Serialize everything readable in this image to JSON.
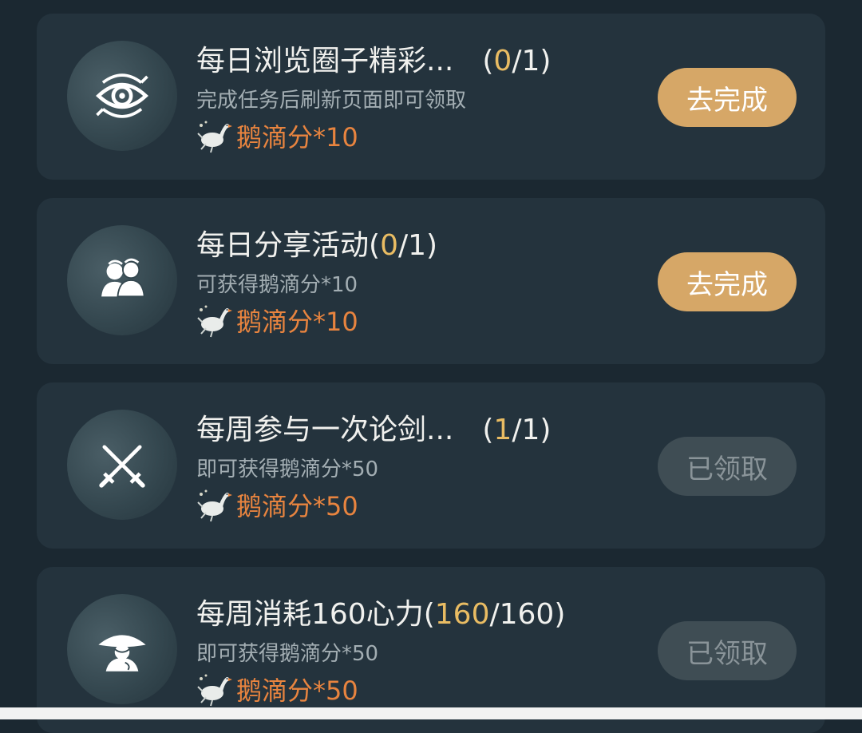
{
  "colors": {
    "page_background": "#1b2831",
    "card_background": "#24333d",
    "title_text": "#f1f1ee",
    "progress_done": "#e9bc63",
    "description_text": "#a3aeb3",
    "reward_text": "#e8843f",
    "button_active": "#d6a767",
    "button_claimed": "#3f4d54"
  },
  "tasks": [
    {
      "icon": "eye-icon",
      "title": "每日浏览圈子精彩...",
      "gap": "　",
      "progress_open": "(",
      "progress_done": "0",
      "progress_total": "/1)",
      "description": "完成任务后刷新页面即可领取",
      "reward_icon": "goose-reward-icon",
      "reward": "鹅滴分*10",
      "button": "去完成",
      "button_state": "active"
    },
    {
      "icon": "people-icon",
      "title": "每日分享活动",
      "gap": "",
      "progress_open": "(",
      "progress_done": "0",
      "progress_total": "/1)",
      "description": "可获得鹅滴分*10",
      "reward_icon": "goose-reward-icon",
      "reward": "鹅滴分*10",
      "button": "去完成",
      "button_state": "active"
    },
    {
      "icon": "crossed-swords-icon",
      "title": "每周参与一次论剑...",
      "gap": "　",
      "progress_open": "(",
      "progress_done": "1",
      "progress_total": "/1)",
      "description": "即可获得鹅滴分*50",
      "reward_icon": "goose-reward-icon",
      "reward": "鹅滴分*50",
      "button": "已领取",
      "button_state": "claimed"
    },
    {
      "icon": "hatted-swordsman-icon",
      "title": "每周消耗160心力",
      "gap": "",
      "progress_open": "(",
      "progress_done": "160",
      "progress_total": "/160)",
      "description": "即可获得鹅滴分*50",
      "reward_icon": "goose-reward-icon",
      "reward": "鹅滴分*50",
      "button": "已领取",
      "button_state": "claimed"
    }
  ]
}
